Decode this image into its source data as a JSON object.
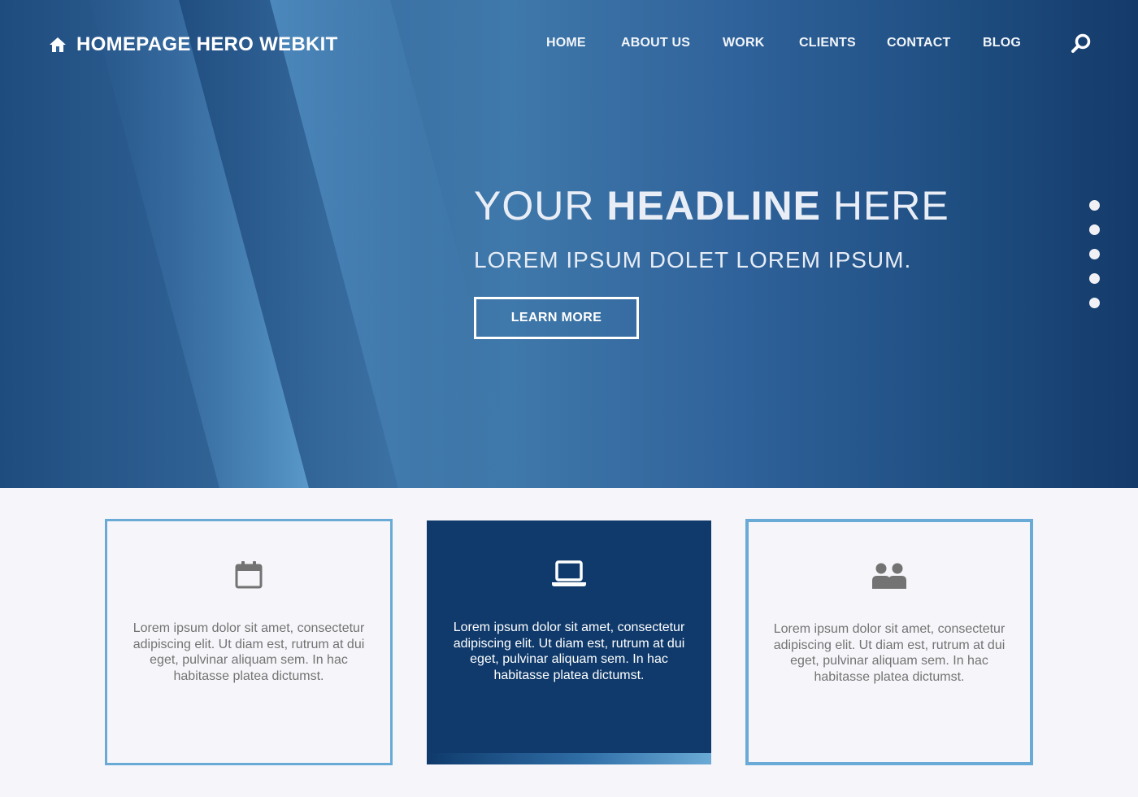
{
  "brand": {
    "name": "HOMEPAGE HERO WEBKIT",
    "icon": "home-icon"
  },
  "nav": {
    "items": [
      {
        "label": "HOME"
      },
      {
        "label": "ABOUT US"
      },
      {
        "label": "WORK"
      },
      {
        "label": "CLIENTS"
      },
      {
        "label": "CONTACT"
      },
      {
        "label": "BLOG"
      }
    ],
    "search_icon": "search-icon"
  },
  "hero": {
    "headline_pre": "YOUR ",
    "headline_bold": "HEADLINE",
    "headline_post": " HERE",
    "subheadline": "LOREM IPSUM DOLET LOREM IPSUM.",
    "cta_label": "LEARN MORE",
    "slides": {
      "count": 5
    }
  },
  "features": [
    {
      "icon": "calendar-icon",
      "style": "outline",
      "text": "Lorem ipsum dolor sit amet, consectetur adipiscing elit. Ut diam est, rutrum at dui eget, pulvinar aliquam sem. In hac habitasse platea dictumst."
    },
    {
      "icon": "laptop-icon",
      "style": "filled",
      "text": "Lorem ipsum dolor sit amet, consectetur adipiscing elit. Ut diam est, rutrum at dui eget, pulvinar aliquam sem. In hac habitasse platea dictumst."
    },
    {
      "icon": "users-icon",
      "style": "outline",
      "text": "Lorem ipsum dolor sit amet, consectetur adipiscing elit. Ut diam est, rutrum at dui eget, pulvinar aliquam sem. In hac habitasse platea dictumst."
    }
  ],
  "colors": {
    "hero_dark": "#143a6a",
    "hero_mid": "#3f78aa",
    "accent": "#6aaad6",
    "card_filled": "#0f3a6b",
    "page_bg": "#f6f6fa",
    "body_text": "#737373"
  }
}
